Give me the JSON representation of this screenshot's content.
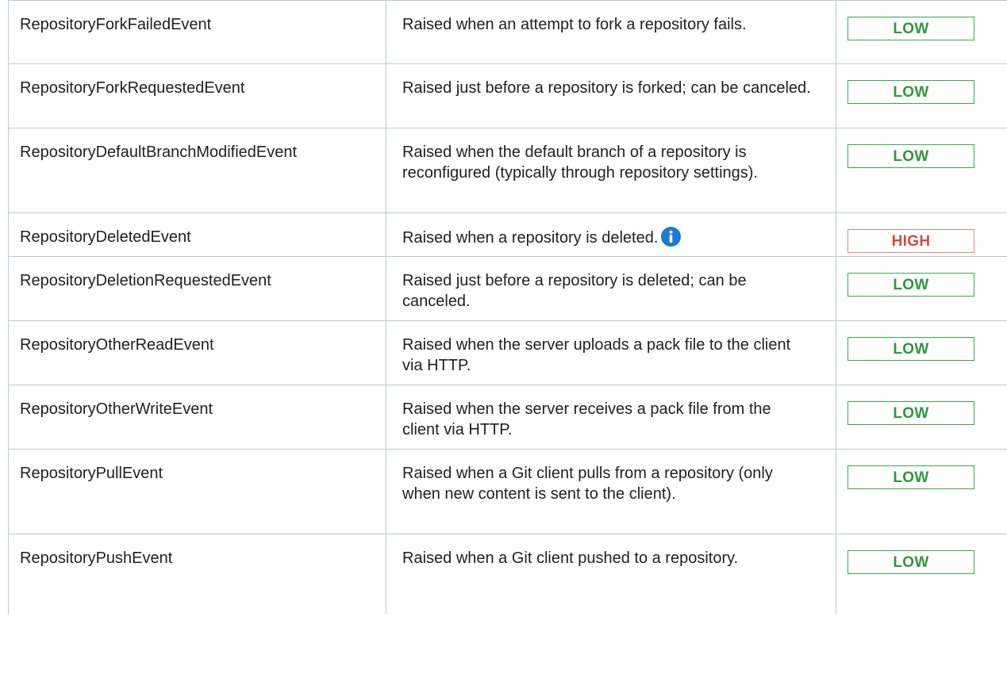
{
  "colors": {
    "low": "#2a9a3c",
    "high": "#d44b3f",
    "info_icon": "#1a7ad4",
    "border": "#c1c7d0"
  },
  "rows": [
    {
      "event": "RepositoryForkFailedEvent",
      "description": "Raised when an attempt to fork a repository fails.",
      "level": "LOW"
    },
    {
      "event": "RepositoryForkRequestedEvent",
      "description": "Raised just before a repository is forked; can be canceled.",
      "level": "LOW"
    },
    {
      "event": "RepositoryDefaultBranchModifiedEvent",
      "description": "Raised when the default branch of a repository is reconfigured (typically through repository settings).",
      "level": "LOW"
    },
    {
      "event": "RepositoryDeletedEvent",
      "description": "Raised when a repository is deleted.",
      "level": "HIGH",
      "info_icon": "info-icon"
    },
    {
      "event": "RepositoryDeletionRequestedEvent",
      "description": "Raised just before a repository is deleted; can be canceled.",
      "level": "LOW"
    },
    {
      "event": "RepositoryOtherReadEvent",
      "description": "Raised when the server uploads a pack file to the client via HTTP.",
      "level": "LOW"
    },
    {
      "event": "RepositoryOtherWriteEvent",
      "description": "Raised when the server receives a pack file from the client via HTTP.",
      "level": "LOW"
    },
    {
      "event": "RepositoryPullEvent",
      "description": "Raised when a Git client pulls from a repository (only when new content is sent to the client).",
      "level": "LOW"
    },
    {
      "event": "RepositoryPushEvent",
      "description": "Raised when a Git client pushed to a repository.",
      "level": "LOW"
    }
  ]
}
